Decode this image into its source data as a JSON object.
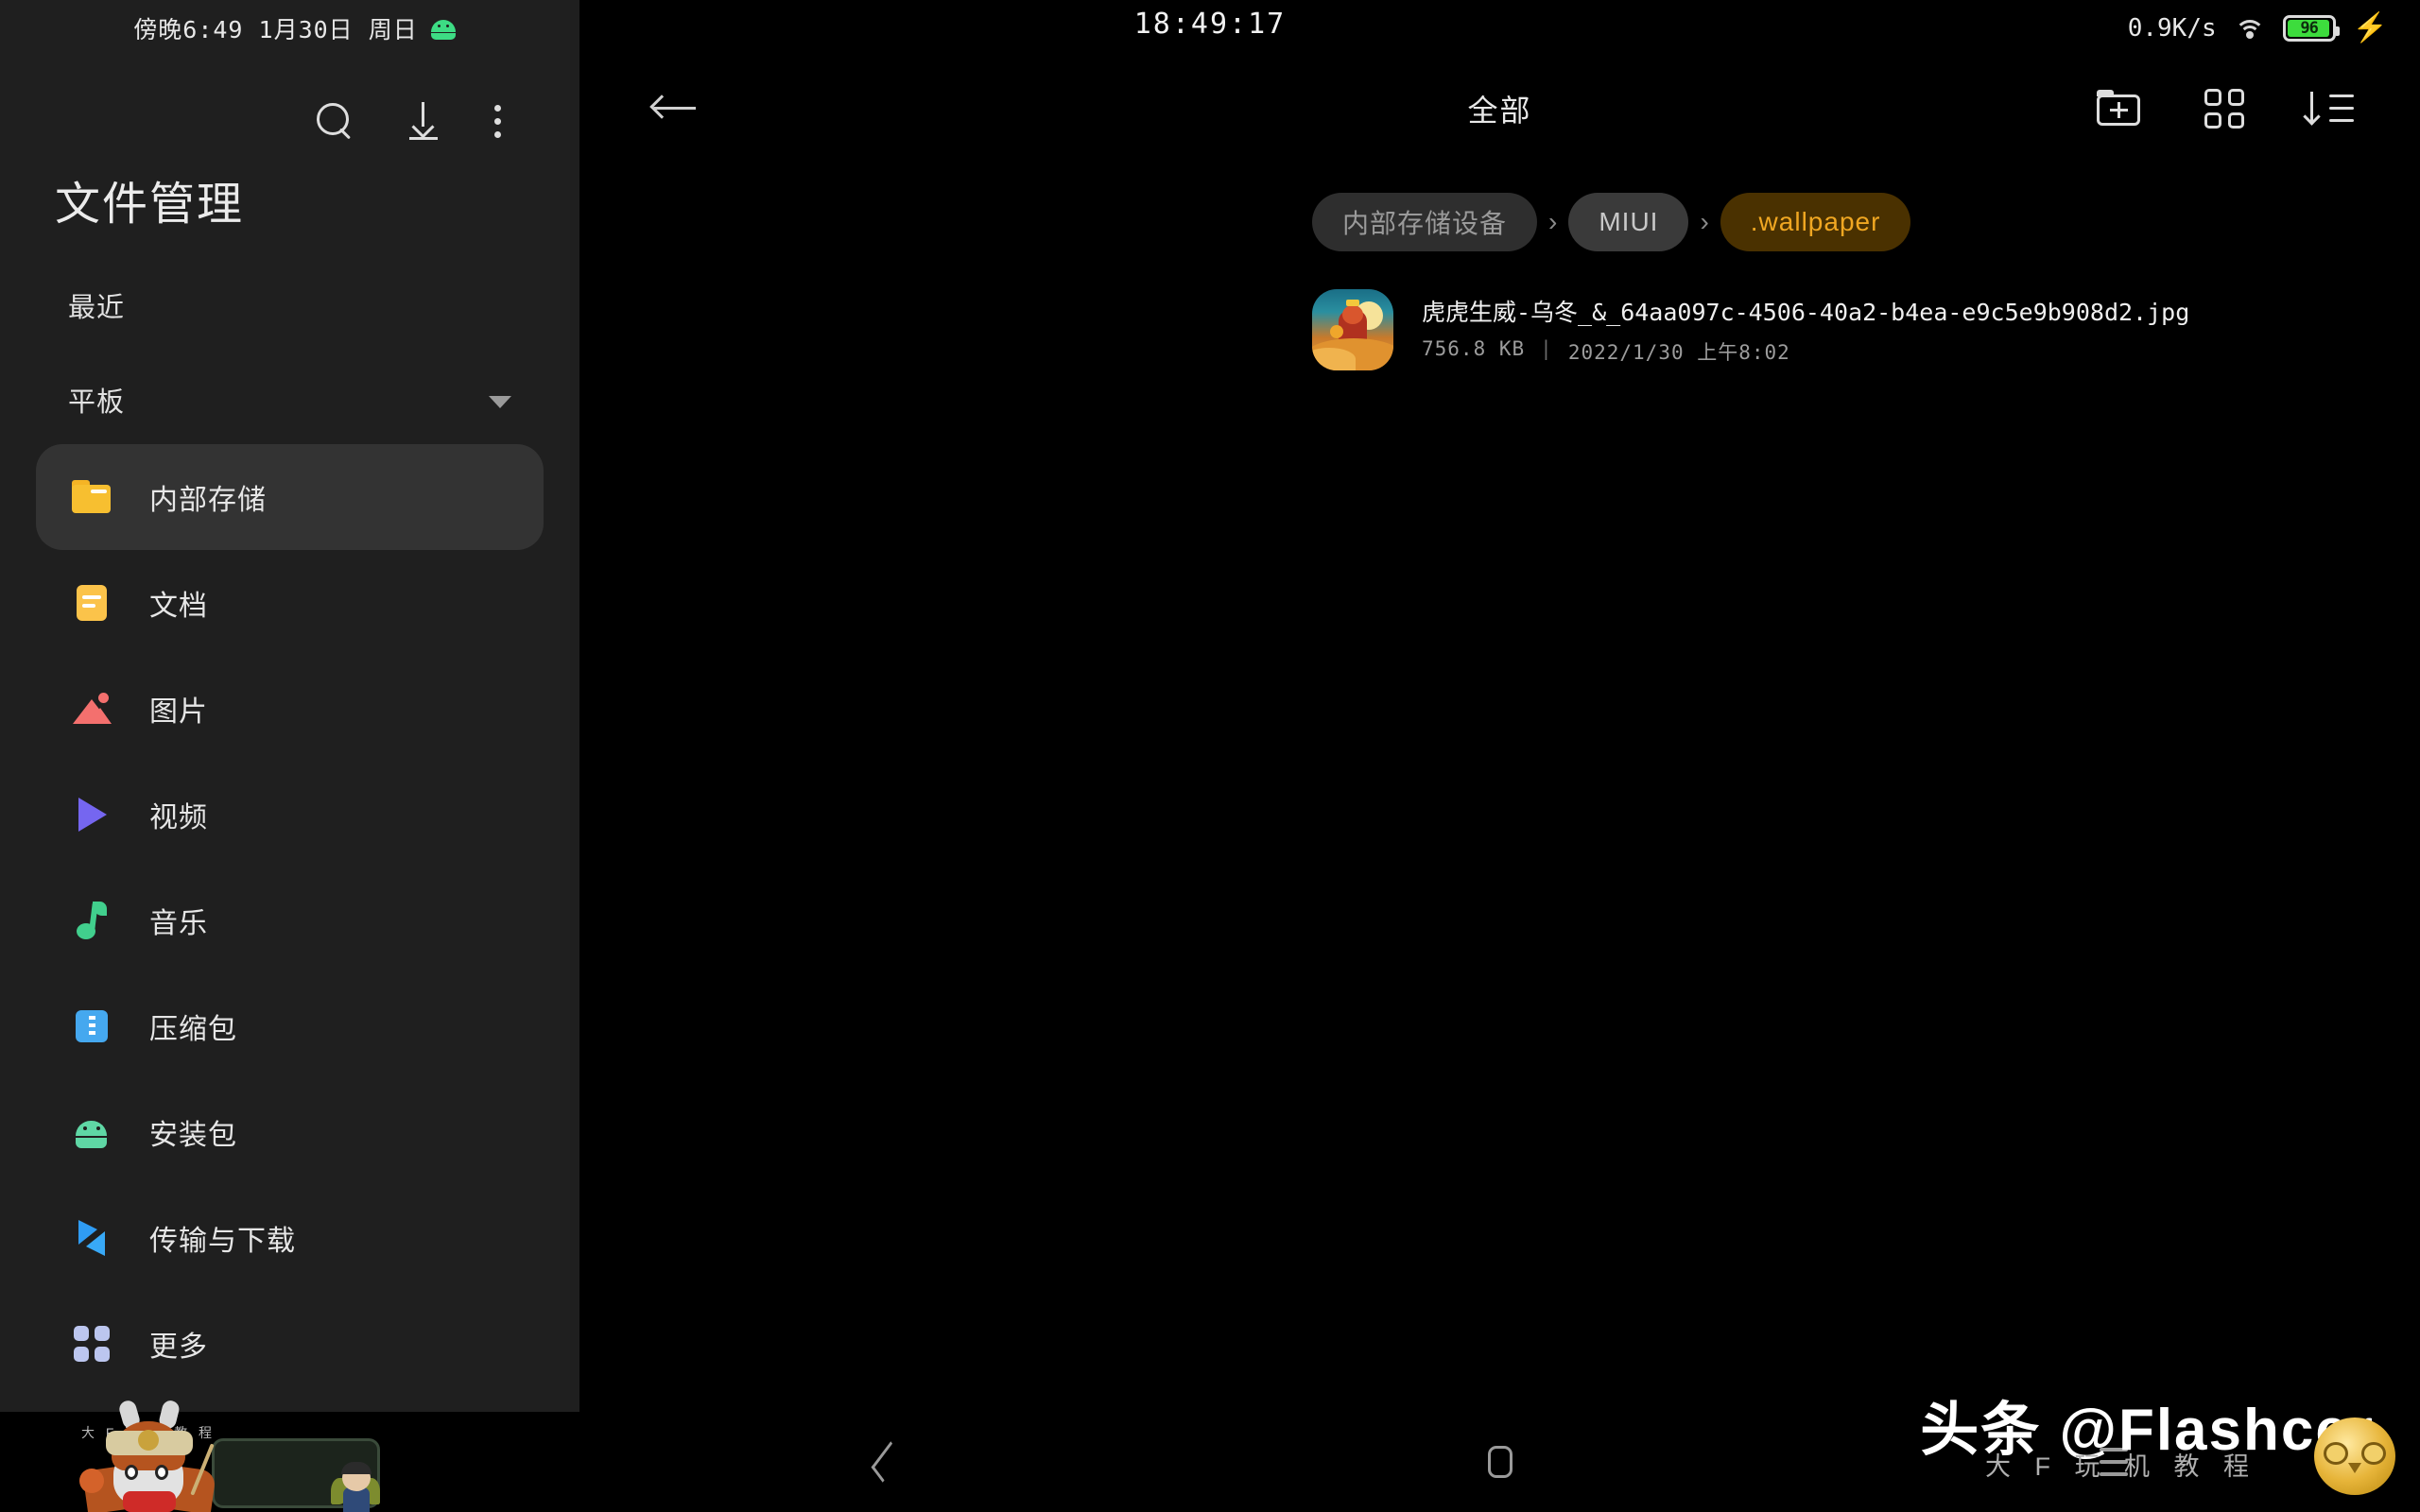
{
  "statusbar": {
    "left_text": "傍晚6:49  1月30日  周日",
    "android_icon": "android-robot-icon",
    "clock": "18:49:17",
    "network_speed": "0.9K/s",
    "wifi_icon": "wifi-icon",
    "battery_percent": "96",
    "charging_icon": "lightning-bolt-icon"
  },
  "sidebar": {
    "app_title": "文件管理",
    "actions": [
      {
        "name": "search-icon",
        "label": "搜索"
      },
      {
        "name": "download-icon",
        "label": "下载"
      },
      {
        "name": "overflow-menu-icon",
        "label": "更多选项"
      }
    ],
    "recent_label": "最近",
    "device_label": "平板",
    "items": [
      {
        "label": "内部存储",
        "icon": "folder-icon",
        "active": true
      },
      {
        "label": "文档",
        "icon": "document-icon",
        "active": false
      },
      {
        "label": "图片",
        "icon": "picture-icon",
        "active": false
      },
      {
        "label": "视频",
        "icon": "video-icon",
        "active": false
      },
      {
        "label": "音乐",
        "icon": "music-icon",
        "active": false
      },
      {
        "label": "压缩包",
        "icon": "archive-icon",
        "active": false
      },
      {
        "label": "安装包",
        "icon": "apk-icon",
        "active": false
      },
      {
        "label": "传输与下载",
        "icon": "transfer-icon",
        "active": false
      },
      {
        "label": "更多",
        "icon": "more-grid-icon",
        "active": false
      }
    ]
  },
  "topbar": {
    "back_icon": "back-arrow-icon",
    "title": "全部",
    "actions": [
      {
        "name": "new-folder-icon",
        "label": "新建文件夹"
      },
      {
        "name": "grid-view-icon",
        "label": "切换视图"
      },
      {
        "name": "sort-icon",
        "label": "排序"
      }
    ]
  },
  "breadcrumbs": [
    {
      "label": "内部存储设备",
      "active": false
    },
    {
      "label": "MIUI",
      "active": false
    },
    {
      "label": ".wallpaper",
      "active": true
    }
  ],
  "breadcrumb_separator": "›",
  "files": [
    {
      "name": "虎虎生威-乌冬_&_64aa097c-4506-40a2-b4ea-e9c5e9b908d2.jpg",
      "size": "756.8 KB",
      "divider": "|",
      "date": "2022/1/30 上午8:02",
      "thumb": "tiger-newyear-artwork-thumbnail"
    }
  ],
  "navbar": [
    {
      "name": "nav-back-icon",
      "label": "返回"
    },
    {
      "name": "nav-home-icon",
      "label": "主页"
    },
    {
      "name": "nav-recents-icon",
      "label": "最近任务"
    }
  ],
  "mascot": {
    "board_text": "大 F 玩 机 教 程",
    "character": "mi-bunny-mascot"
  },
  "watermark": {
    "main": "头条 @Flashcer",
    "sub": "大 F 玩 机 教 程",
    "owl": "golden-owl-mascot"
  },
  "colors": {
    "sidebar_bg": "#1f1f1f",
    "main_bg": "#000000",
    "active_item_bg": "#333333",
    "accent_amber": "#f0a722",
    "accent_amber_bg": "#4a3100",
    "battery_green": "#3ddc3d",
    "folder_yellow": "#f7bf30"
  }
}
